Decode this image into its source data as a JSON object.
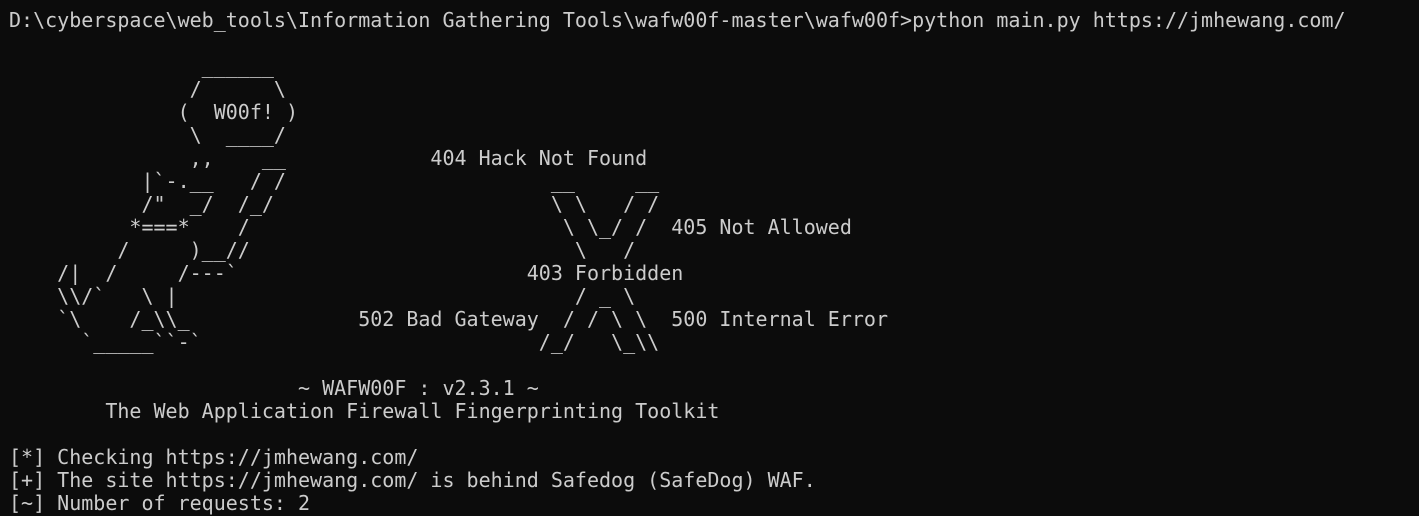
{
  "terminal": {
    "lines": [
      "D:\\cyberspace\\web_tools\\Information Gathering Tools\\wafw00f-master\\wafw00f>python main.py https://jmhewang.com/",
      "",
      "                ______",
      "               /      \\",
      "              (  W00f! )",
      "               \\  ____/",
      "               ,,    __            404 Hack Not Found",
      "           |`-.__   / /                      __     __",
      "           /\"  _/  /_/                       \\ \\   / /",
      "          *===*    /                          \\ \\_/ /  405 Not Allowed",
      "         /     )__//                           \\   /",
      "    /|  /     /---`                        403 Forbidden",
      "    \\\\/`   \\ |                                 / _ \\",
      "    `\\    /_\\\\_              502 Bad Gateway  / / \\ \\  500 Internal Error",
      "      `_____``-`                            /_/   \\_\\\\",
      "",
      "                        ~ WAFW00F : v2.3.1 ~",
      "        The Web Application Firewall Fingerprinting Toolkit",
      "",
      "[*] Checking https://jmhewang.com/",
      "[+] The site https://jmhewang.com/ is behind Safedog (SafeDog) WAF.",
      "[~] Number of requests: 2"
    ]
  }
}
